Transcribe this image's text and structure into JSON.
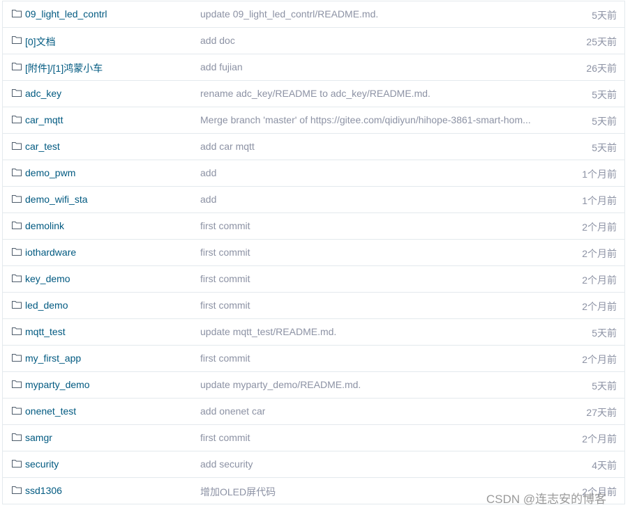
{
  "rows": [
    {
      "name": "09_light_led_contrl",
      "message": "update 09_light_led_contrl/README.md.",
      "time": "5天前"
    },
    {
      "name": "[0]文档",
      "message": "add doc",
      "time": "25天前"
    },
    {
      "name": "[附件]/[1]鸿蒙小车",
      "message": "add fujian",
      "time": "26天前"
    },
    {
      "name": "adc_key",
      "message": "rename adc_key/README to adc_key/README.md.",
      "time": "5天前"
    },
    {
      "name": "car_mqtt",
      "message": "Merge branch 'master' of https://gitee.com/qidiyun/hihope-3861-smart-hom...",
      "time": "5天前"
    },
    {
      "name": "car_test",
      "message": "add car mqtt",
      "time": "5天前"
    },
    {
      "name": "demo_pwm",
      "message": "add",
      "time": "1个月前"
    },
    {
      "name": "demo_wifi_sta",
      "message": "add",
      "time": "1个月前"
    },
    {
      "name": "demolink",
      "message": "first commit",
      "time": "2个月前"
    },
    {
      "name": "iothardware",
      "message": "first commit",
      "time": "2个月前"
    },
    {
      "name": "key_demo",
      "message": "first commit",
      "time": "2个月前"
    },
    {
      "name": "led_demo",
      "message": "first commit",
      "time": "2个月前"
    },
    {
      "name": "mqtt_test",
      "message": "update mqtt_test/README.md.",
      "time": "5天前"
    },
    {
      "name": "my_first_app",
      "message": "first commit",
      "time": "2个月前"
    },
    {
      "name": "myparty_demo",
      "message": "update myparty_demo/README.md.",
      "time": "5天前"
    },
    {
      "name": "onenet_test",
      "message": "add onenet car",
      "time": "27天前"
    },
    {
      "name": "samgr",
      "message": "first commit",
      "time": "2个月前"
    },
    {
      "name": "security",
      "message": "add security",
      "time": "4天前"
    },
    {
      "name": "ssd1306",
      "message": "增加OLED屏代码",
      "time": "2个月前"
    }
  ],
  "icon": "folder-icon",
  "watermark": "CSDN @连志安的博客"
}
